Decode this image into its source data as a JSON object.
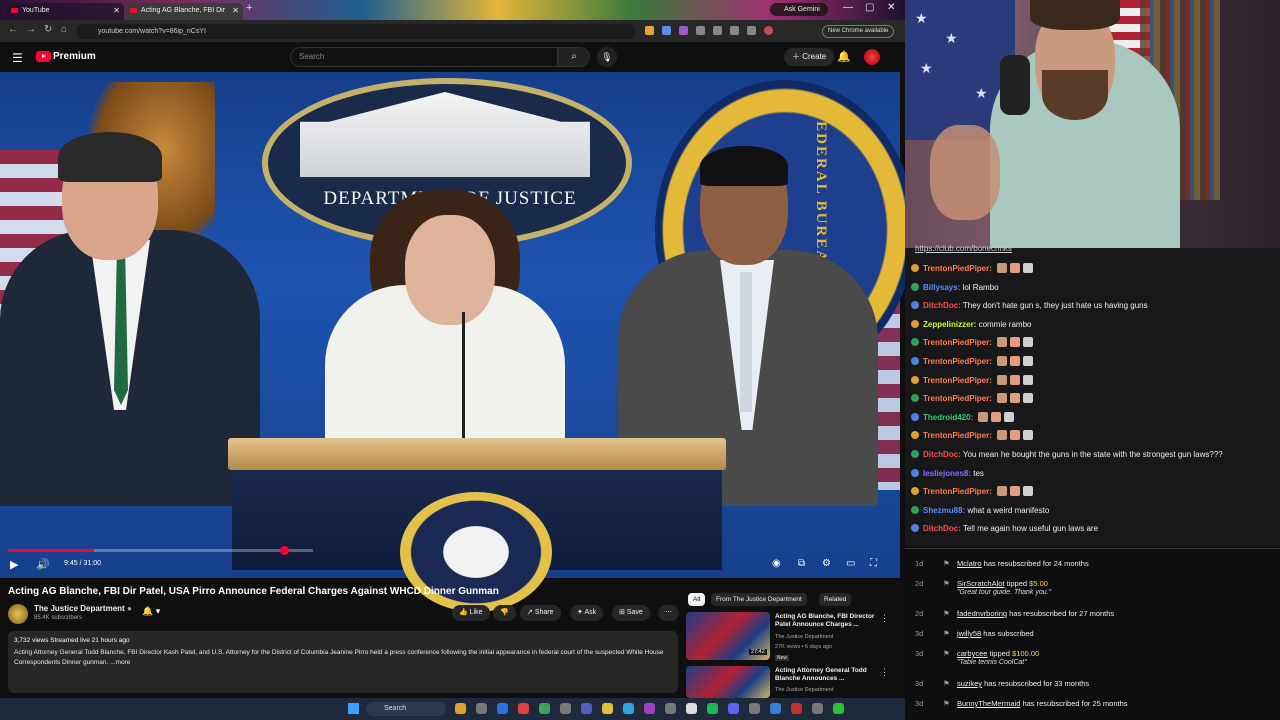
{
  "browser": {
    "tabs": [
      {
        "label": "YouTube"
      },
      {
        "label": "Acting AG Blanche, FBI Dir"
      }
    ],
    "new_tab": "+",
    "ask_gemini": "Ask Gemini",
    "url": "youtube.com/watch?v=86ip_nCsYI",
    "new_chrome": "New Chrome available"
  },
  "youtube": {
    "logo_text": "Premium",
    "search_placeholder": "Search",
    "create_label": "Create"
  },
  "video": {
    "backdrop_text": "DEPARTMENT OF JUSTICE",
    "fbi_text": "FEDERAL BUREAU OF JUSTICE",
    "timecode": "9:45 / 31:00",
    "progress": 0.31,
    "title": "Acting AG Blanche, FBI Dir Patel, USA Pirro Announce Federal Charges Against WHCD Dinner Gunman",
    "channel": "The Justice Department",
    "subscribers": "85.4K subscribers",
    "actions": {
      "like": "Like",
      "share": "Share",
      "ask": "Ask",
      "save": "Save"
    },
    "meta": "3,732 views  Streamed live 21 hours ago",
    "description": "Acting Attorney General Todd Blanche, FBI Director Kash Patel, and U.S. Attorney for the District of Columbia Jeanine Pirro held a press conference following the initial appearance in federal court of the suspected White House Correspondents Dinner gunman.",
    "more": "...more"
  },
  "related": {
    "chips": [
      "All",
      "From The Justice Department",
      "Related"
    ],
    "items": [
      {
        "title": "Acting AG Blanche, FBI Director Patel Announce Charges ...",
        "channel": "The Justice Department",
        "meta": "27K views • 6 days ago",
        "badge": "New",
        "duration": "27:42"
      },
      {
        "title": "Acting Attorney General Todd Blanche Announces ...",
        "channel": "The Justice Department"
      }
    ]
  },
  "taskbar": {
    "search": "Search"
  },
  "chat": {
    "link": "https://club.com/bonecrinks",
    "messages": [
      {
        "name": "TrentonPiedPiper:",
        "color": "#ff7f50",
        "text": ""
      },
      {
        "name": "Billysays:",
        "color": "#5b8cff",
        "text": "lol Rambo"
      },
      {
        "name": "DitchDoc:",
        "color": "#ff4a4a",
        "text": "They don't hate gun s, they just hate us having guns"
      },
      {
        "name": "Zeppelinizzer:",
        "color": "#c7ff2e",
        "text": "commie rambo"
      },
      {
        "name": "TrentonPiedPiper:",
        "color": "#ff7f50",
        "text": ""
      },
      {
        "name": "TrentonPiedPiper:",
        "color": "#ff7f50",
        "text": ""
      },
      {
        "name": "TrentonPiedPiper:",
        "color": "#ff7f50",
        "text": ""
      },
      {
        "name": "TrentonPiedPiper:",
        "color": "#ff7f50",
        "text": ""
      },
      {
        "name": "Thedroid420:",
        "color": "#2ecc71",
        "text": ""
      },
      {
        "name": "TrentonPiedPiper:",
        "color": "#ff7f50",
        "text": ""
      },
      {
        "name": "DitchDoc:",
        "color": "#ff4a4a",
        "text": "You mean he bought the guns in the state with the strongest gun laws???"
      },
      {
        "name": "lesliejones8:",
        "color": "#8a6bff",
        "text": "tes"
      },
      {
        "name": "TrentonPiedPiper:",
        "color": "#ff7f50",
        "text": ""
      },
      {
        "name": "Shezmu88:",
        "color": "#5b8cff",
        "text": "what a weird manifesto"
      },
      {
        "name": "DitchDoc:",
        "color": "#ff4a4a",
        "text": "Tell me again how useful gun laws are"
      }
    ]
  },
  "events": [
    {
      "time": "1d",
      "name": "Mclatro",
      "text": "has resubscribed for 24 months",
      "note": ""
    },
    {
      "time": "2d",
      "name": "SirScratchAlot",
      "text": "tipped",
      "amount": "$5.00",
      "note": "\"Great tour guide. Thank you.\""
    },
    {
      "time": "2d",
      "name": "fadednvrboring",
      "text": "has resubscribed for 27 months",
      "note": ""
    },
    {
      "time": "3d",
      "name": "jwilly58",
      "text": "has subscribed",
      "note": ""
    },
    {
      "time": "3d",
      "name": "carbycee",
      "text": "tipped",
      "amount": "$100.00",
      "note": "\"Table tennis CoolCat\""
    },
    {
      "time": "3d",
      "name": "suzikey",
      "text": "has resubscribed for 33 months",
      "note": ""
    },
    {
      "time": "3d",
      "name": "BunnyTheMermaid",
      "text": "has resubscribed for 25 months",
      "note": ""
    }
  ]
}
